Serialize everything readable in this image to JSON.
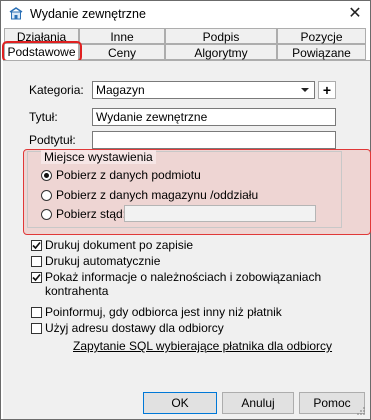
{
  "window": {
    "title": "Wydanie zewnętrzne",
    "close": "✕"
  },
  "tabs": {
    "row1": [
      "Działania",
      "Inne",
      "Podpis elektroniczny",
      "Pozycje"
    ],
    "row2": [
      "Podstawowe",
      "Ceny",
      "Algorytmy",
      "Powiązane"
    ],
    "active": "Podstawowe"
  },
  "form": {
    "kategoria": {
      "label": "Kategoria:",
      "value": "Magazyn",
      "plus": "+"
    },
    "tytul": {
      "label": "Tytuł:",
      "value": "Wydanie zewnętrzne"
    },
    "podtytul": {
      "label": "Podtytuł:",
      "value": ""
    }
  },
  "group": {
    "title": "Miejsce wystawienia",
    "options": [
      "Pobierz z danych podmiotu",
      "Pobierz z danych magazynu /oddziału",
      "Pobierz stąd:"
    ],
    "selected_index": 0,
    "stad_value": ""
  },
  "checks": [
    {
      "label": "Drukuj dokument po zapisie",
      "checked": true
    },
    {
      "label": "Drukuj automatycznie",
      "checked": false
    },
    {
      "label": "Pokaż informacje o należnościach i zobowiązaniach kontrahenta",
      "checked": true
    },
    {
      "label": "Poinformuj, gdy odbiorca jest inny niż płatnik",
      "checked": false
    },
    {
      "label": "Użyj adresu dostawy dla odbiorcy",
      "checked": false
    }
  ],
  "sql_link": "Zapytanie SQL wybierające płatnika dla odbiorcy",
  "buttons": {
    "ok": "OK",
    "cancel": "Anuluj",
    "help": "Pomoc"
  },
  "colors": {
    "highlight": "#e02020",
    "accent": "#0078d7",
    "panel": "#f0f0f0"
  }
}
